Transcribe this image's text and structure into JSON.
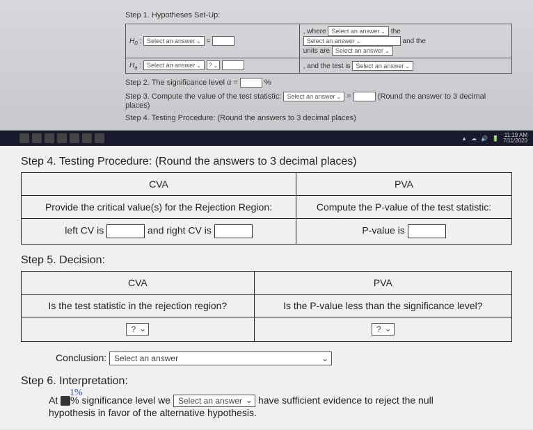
{
  "top": {
    "step1": "Step 1. Hypotheses Set-Up:",
    "h0_label": "H",
    "h0_sub": "0",
    "ha_label": "H",
    "ha_sub": "a",
    "select_answer": "Select an answer",
    "q_select": "?",
    "where": ", where",
    "the": "the",
    "and_the": "and the",
    "units_are": "units are",
    "and_test_is": ", and the test is",
    "step2": "Step 2. The significance level α =",
    "pct": "%",
    "step3": "Step 3. Compute the value of the test statistic:",
    "round3": "(Round the answer to 3 decimal places)",
    "step4": "Step 4. Testing Procedure: (Round the answers to 3 decimal places)"
  },
  "taskbar": {
    "time": "11:19 AM",
    "date": "7/11/2020"
  },
  "btm": {
    "step4": "Step 4. Testing Procedure: (Round the answers to 3 decimal places)",
    "cva": "CVA",
    "pva": "PVA",
    "provide_cv": "Provide the critical value(s) for the Rejection Region:",
    "compute_p": "Compute the P-value of the test statistic:",
    "left_cv": "left CV is",
    "right_cv": "and right CV is",
    "pvalue_is": "P-value is",
    "step5": "Step 5. Decision:",
    "q_rr": "Is the test statistic in the rejection region?",
    "q_pv": "Is the P-value less than the significance level?",
    "qmark": "?",
    "conclusion": "Conclusion:",
    "select_answer": "Select an answer",
    "step6": "Step 6. Interpretation:",
    "annot": "1%",
    "at": "At",
    "siglevel": "% significance level we",
    "suff": "have sufficient evidence to reject the null",
    "hypo": "hypothesis in favor of the alternative hypothesis."
  }
}
